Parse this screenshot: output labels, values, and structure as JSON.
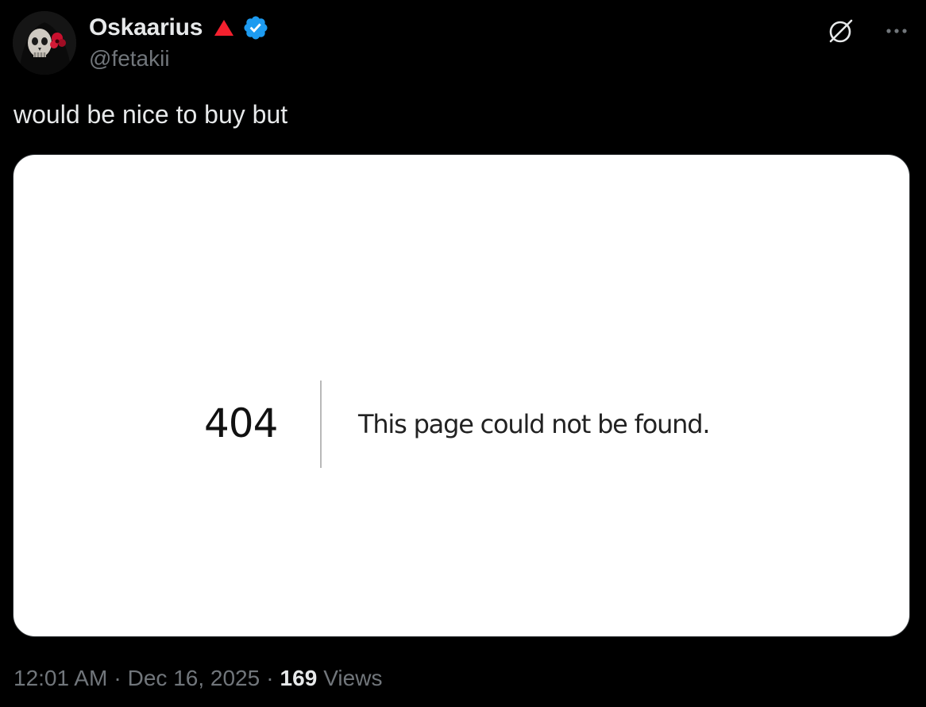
{
  "author": {
    "display_name": "Oskaarius",
    "handle": "@fetakii",
    "avatar_icon": "skull-avatar",
    "badge_icon": "red-triangle-icon",
    "verified_icon": "verified-badge-icon",
    "verified_color": "#1d9bf0",
    "triangle_color": "#f4212e"
  },
  "actions": {
    "grok_icon": "grok-icon",
    "more_icon": "more-icon"
  },
  "tweet": {
    "text": "would be nice to buy but"
  },
  "media": {
    "error_code": "404",
    "error_message": "This page could not be found."
  },
  "meta": {
    "time": "12:01 AM",
    "separator": "·",
    "date": "Dec 16, 2025",
    "views_count": "169",
    "views_label": "Views"
  }
}
